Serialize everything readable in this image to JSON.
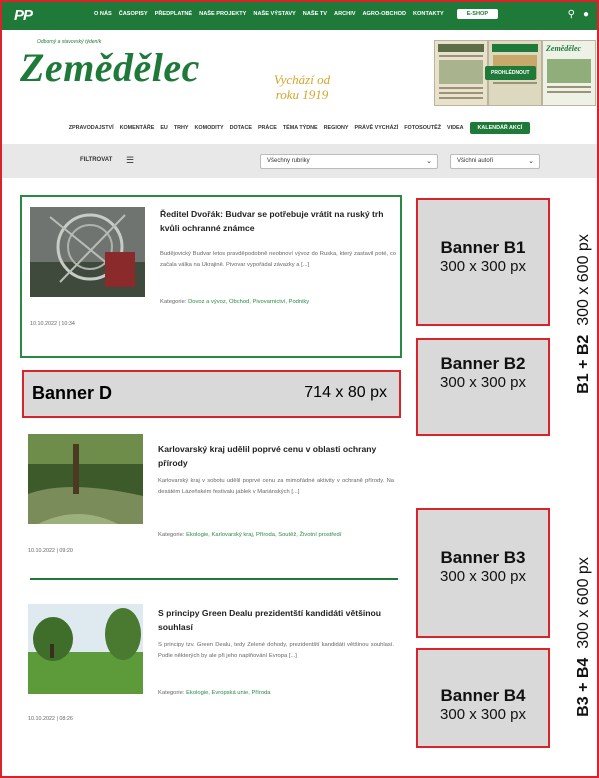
{
  "topbar": {
    "logo": "PP",
    "nav": [
      "O NÁS",
      "ČASOPISY",
      "PŘEDPLATNÉ",
      "NAŠE PROJEKTY",
      "NAŠE VÝSTAVY",
      "NAŠE TV",
      "ARCHIV",
      "AGRO-OBCHOD",
      "KONTAKTY"
    ],
    "eshop": "E-SHOP"
  },
  "masthead": {
    "tagline": "Odborný a stavovský týdeník",
    "brand": "Zemědělec",
    "since_line1": "Vychází od",
    "since_line2": "roku 1919",
    "view_button": "PROHLÉDNOUT",
    "cover3_title": "Zemědělec"
  },
  "mainnav": {
    "items": [
      "ZPRAVODAJSTVÍ",
      "KOMENTÁŘE",
      "EU",
      "TRHY",
      "KOMODITY",
      "DOTACE",
      "PRÁCE",
      "TÉMA TÝDNE",
      "REGIONY",
      "PRÁVĚ VYCHÁZÍ",
      "FOTOSOUTĚŽ",
      "VIDEA"
    ],
    "cta": "KALENDÁŘ AKCÍ"
  },
  "filter": {
    "label": "FILTROVAT",
    "rubric": "Všechny rubriky",
    "author": "Všichni autoři"
  },
  "articles": [
    {
      "title": "Ředitel Dvořák: Budvar se potřebuje vrátit na ruský trh kvůli ochranné známce",
      "excerpt": "Budějovický Budvar letos pravděpodobně neobnoví vývoz do Ruska, který zastavil poté, co začala válka na Ukrajině. Pivovar vypořádal závazky a [...]",
      "category_label": "Kategorie:",
      "categories": "Dovoz a vývoz, Obchod, Pivovarnictví, Podniky",
      "date": "10.10.2022 | 10:34"
    },
    {
      "title": "Karlovarský kraj udělil poprvé cenu v oblasti ochrany přírody",
      "excerpt": "Karlovarský kraj v sobotu udělil poprvé cenu za mimořádné aktivity v ochraně přírody. Na desátém Lázeňském festivalu jablek v Mariánských [...]",
      "category_label": "Kategorie:",
      "categories": "Ekologie, Karlovarský kraj, Příroda, Soutěž, Životní prostředí",
      "date": "10.10.2022 | 09:20"
    },
    {
      "title": "S principy Green Dealu prezidentští kandidáti většinou souhlasí",
      "excerpt": "S principy tzv. Green Dealu, tedy Zelené dohody, prezidentští kandidáti většinou souhlasí. Podle některých by ale při jeho naplňování Evropa [...]",
      "category_label": "Kategorie:",
      "categories": "Ekologie, Evropská unie, Příroda",
      "date": "10.10.2022 | 08:26"
    }
  ],
  "banners": {
    "b1": {
      "name": "Banner B1",
      "size": "300 x 300 px"
    },
    "b2": {
      "name": "Banner B2",
      "size": "300 x 300 px"
    },
    "b3": {
      "name": "Banner B3",
      "size": "300 x 300 px"
    },
    "b4": {
      "name": "Banner B4",
      "size": "300 x 300 px"
    },
    "d": {
      "name": "Banner D",
      "size": "714 x 80 px"
    },
    "group1_bold": "B1 + B2",
    "group1_size": "300 x 600 px",
    "group2_bold": "B3 + B4",
    "group2_size": "300 x 600 px"
  },
  "colors": {
    "brand_green": "#1f7a3a",
    "banner_border": "#d8232a",
    "banner_fill": "#d9d9d9"
  }
}
